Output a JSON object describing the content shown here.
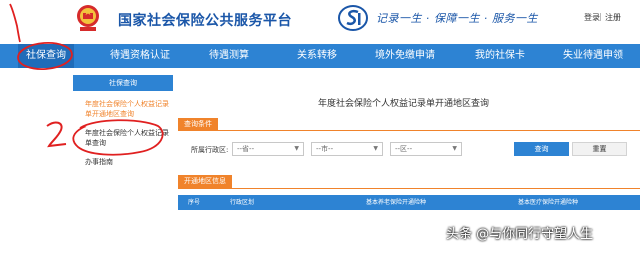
{
  "header": {
    "site_title": "国家社会保险公共服务平台",
    "slogan": "记录一生 · 保障一生 · 服务一生",
    "login": "登录",
    "separator": "|",
    "register": "注册"
  },
  "nav": {
    "items": [
      {
        "label": "社保查询",
        "active": true
      },
      {
        "label": "待遇资格认证"
      },
      {
        "label": "待遇测算"
      },
      {
        "label": "关系转移"
      },
      {
        "label": "境外免缴申请"
      },
      {
        "label": "我的社保卡"
      },
      {
        "label": "失业待遇申领"
      }
    ]
  },
  "sidebar": {
    "title": "社保查询",
    "items": [
      {
        "label": "年度社会保险个人权益记录单开通地区查询",
        "active": true
      },
      {
        "label": "年度社会保险个人权益记录单查询"
      },
      {
        "label": "办事指南"
      }
    ]
  },
  "main": {
    "title": "年度社会保险个人权益记录单开通地区查询",
    "query_section": "查询条件",
    "region_label": "所属行政区:",
    "selects": [
      "--省--",
      "--市--",
      "--区--"
    ],
    "query_button": "查询",
    "reset_button": "重置",
    "results_section": "开通地区信息",
    "table_headers": [
      "序号",
      "行政区划",
      "基本养老保险开通险种",
      "基本医疗保险开通险种"
    ]
  },
  "annotations": {
    "marks": [
      "1",
      "2"
    ],
    "mark_color": "#e02020"
  },
  "watermark": {
    "text": "头条 @与你同行守望人生"
  },
  "colors": {
    "brand_blue": "#2d83d3",
    "accent_orange": "#f0832b",
    "title_blue": "#1a56a8"
  }
}
